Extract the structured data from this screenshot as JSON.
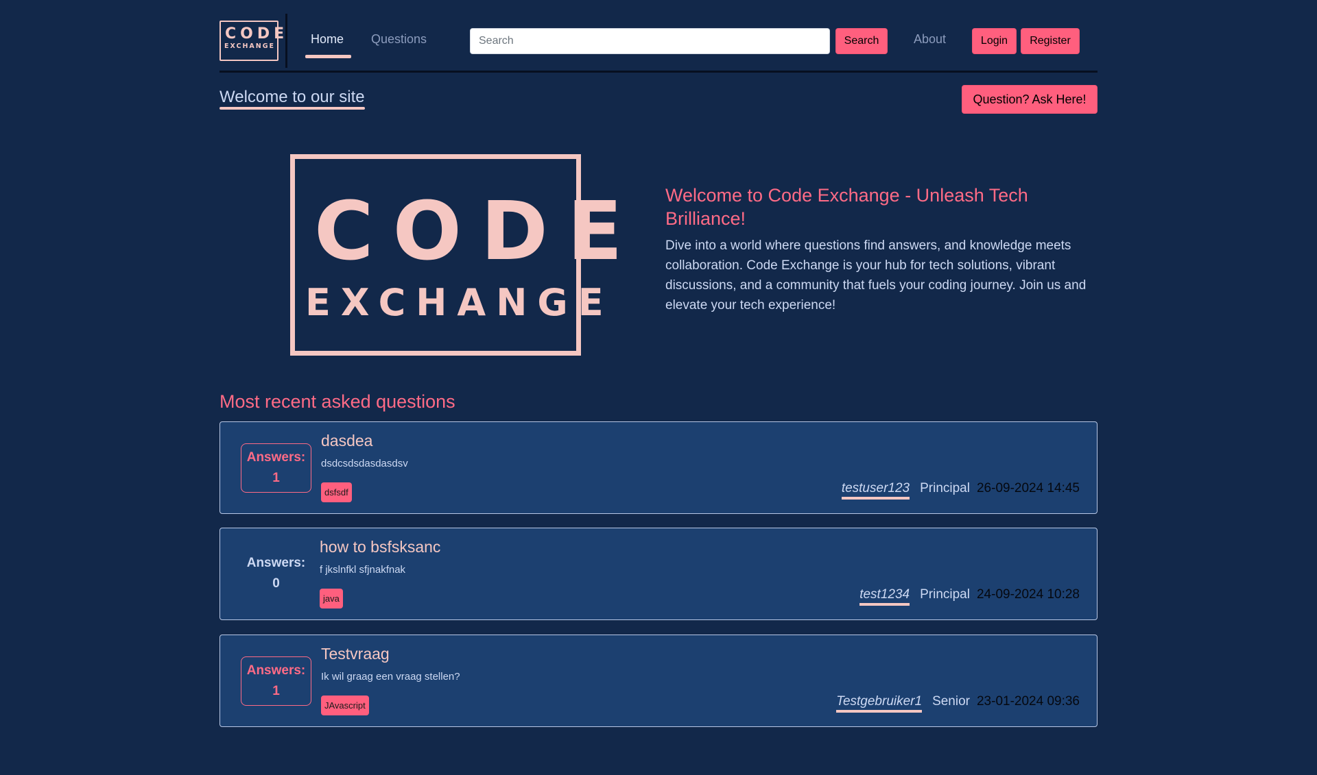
{
  "nav": {
    "logo_line1": "CODE",
    "logo_line2": "EXCHANGE",
    "home": "Home",
    "questions": "Questions",
    "search_placeholder": "Search",
    "search_button": "Search",
    "about": "About",
    "login": "Login",
    "register": "Register"
  },
  "welcome": {
    "title": "Welcome to our site",
    "ask_button": "Question? Ask Here!"
  },
  "hero": {
    "logo_line1": "CODE",
    "logo_line2": "EXCHANGE",
    "heading": "Welcome to Code Exchange - Unleash Tech Brilliance!",
    "text": "Dive into a world where questions find answers, and knowledge meets collaboration. Code Exchange is your hub for tech solutions, vibrant discussions, and a community that fuels your coding journey. Join us and elevate your tech experience!"
  },
  "recent": {
    "title": "Most recent asked questions",
    "answers_label": "Answers:",
    "questions": [
      {
        "answers": "1",
        "title": "dasdea",
        "body": "dsdcsdsdasdasdsv",
        "tag": "dsfsdf",
        "user": "testuser123",
        "rank": "Principal",
        "date": "26-09-2024 14:45"
      },
      {
        "answers": "0",
        "title": "how to bsfsksanc",
        "body": "f jkslnfkl sfjnakfnak",
        "tag": "java",
        "user": "test1234",
        "rank": "Principal",
        "date": "24-09-2024 10:28"
      },
      {
        "answers": "1",
        "title": "Testvraag",
        "body": "Ik wil graag een vraag stellen?",
        "tag": "JAvascript",
        "user": "Testgebruiker1",
        "rank": "Senior",
        "date": "23-01-2024 09:36"
      }
    ]
  },
  "colors": {
    "background": "#12284a",
    "card": "#1c4070",
    "accent": "#ff5f7e",
    "heading_pink": "#ff6b86",
    "logo_peach": "#f5c7c2"
  }
}
